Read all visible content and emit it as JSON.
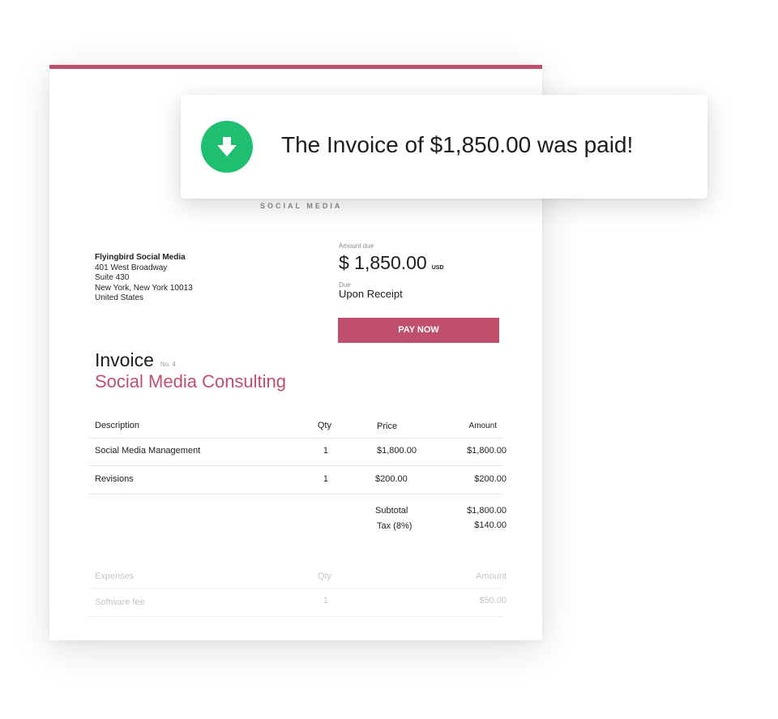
{
  "brand": {
    "tagline": "SOCIAL MEDIA"
  },
  "colors": {
    "accent": "#c04f6e",
    "success": "#1fbf72"
  },
  "sender": {
    "company": "Flyingbird Social Media",
    "address_line1": "401 West Broadway",
    "address_line2": "Suite 430",
    "city_line": "New York, New York 10013",
    "country": "United States"
  },
  "amount": {
    "label": "Amount due",
    "value": "$ 1,850.00",
    "currency": "USD",
    "due_label": "Due",
    "due_value": "Upon Receipt"
  },
  "pay_button": {
    "label": "PAY NOW"
  },
  "invoice": {
    "title": "Invoice",
    "number": "No. 4",
    "subject": "Social Media Consulting"
  },
  "items_table": {
    "headers": {
      "description": "Description",
      "qty": "Qty",
      "price": "Price",
      "amount": "Amount"
    },
    "rows": [
      {
        "description": "Social Media Management",
        "qty": "1",
        "price": "$1,800.00",
        "amount": "$1,800.00"
      },
      {
        "description": "Revisions",
        "qty": "1",
        "price": "$200.00",
        "amount": "$200.00"
      }
    ]
  },
  "totals": {
    "subtotal_label": "Subtotal",
    "subtotal_value": "$1,800.00",
    "tax_label": "Tax (8%)",
    "tax_value": "$140.00"
  },
  "expenses_table": {
    "headers": {
      "description": "Expenses",
      "qty": "Qty",
      "amount": "Amount"
    },
    "rows": [
      {
        "description": "Software fee",
        "qty": "1",
        "amount": "$50.00"
      }
    ]
  },
  "toast": {
    "icon": "download-arrow-icon",
    "message": "The Invoice of $1,850.00 was paid!"
  }
}
